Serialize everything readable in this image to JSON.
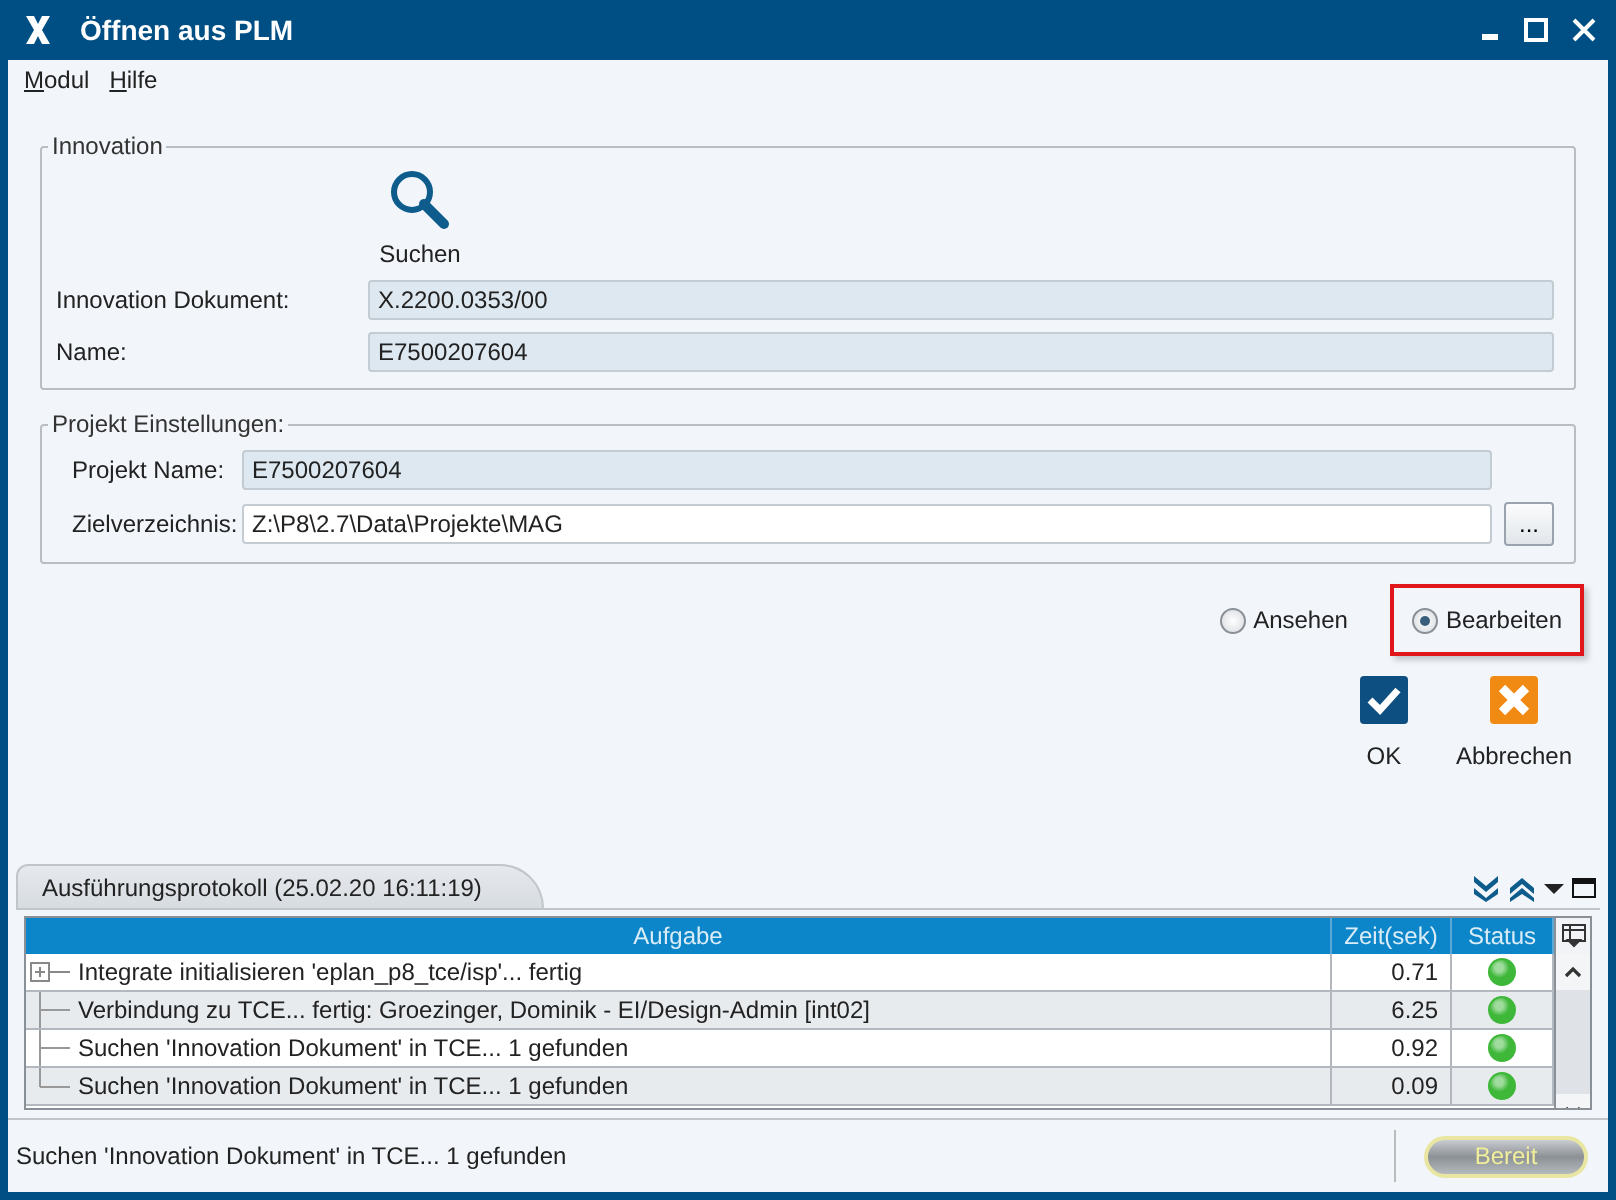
{
  "window": {
    "title": "Öffnen aus PLM"
  },
  "menu": [
    {
      "label": "Modul"
    },
    {
      "label": "Hilfe"
    }
  ],
  "innovation": {
    "legend": "Innovation",
    "search_label": "Suchen",
    "fields": [
      {
        "label": "Innovation Dokument:",
        "value": "X.2200.0353/00",
        "readonly": true
      },
      {
        "label": "Name:",
        "value": "E7500207604",
        "readonly": true
      }
    ]
  },
  "projekt": {
    "legend": "Projekt Einstellungen:",
    "fields": [
      {
        "label": "Projekt Name:",
        "value": "E7500207604",
        "readonly": true
      },
      {
        "label": "Zielverzeichnis:",
        "value": "Z:\\P8\\2.7\\Data\\Projekte\\MAG",
        "readonly": false,
        "browse": "..."
      }
    ]
  },
  "mode": [
    {
      "label": "Ansehen",
      "selected": false,
      "highlighted": false
    },
    {
      "label": "Bearbeiten",
      "selected": true,
      "highlighted": true
    }
  ],
  "actions": [
    {
      "kind": "ok",
      "label": "OK"
    },
    {
      "kind": "cancel",
      "label": "Abbrechen"
    }
  ],
  "log": {
    "tab": "Ausführungsprotokoll (25.02.20 16:11:19)",
    "columns": [
      "Aufgabe",
      "Zeit(sek)",
      "Status"
    ],
    "rows": [
      {
        "kind": "collapsed",
        "task": "Integrate initialisieren 'eplan_p8_tce/isp'... fertig",
        "time": "0.71",
        "color": "#3fb83a"
      },
      {
        "kind": "leaf",
        "task": "Verbindung zu TCE... fertig: Groezinger, Dominik - EI/Design-Admin [int02]",
        "time": "6.25",
        "color": "#3fb83a"
      },
      {
        "kind": "leaf",
        "task": "Suchen 'Innovation Dokument' in TCE... 1 gefunden",
        "time": "0.92",
        "color": "#3fb83a"
      },
      {
        "kind": "leaf",
        "task": "Suchen 'Innovation Dokument' in TCE... 1 gefunden",
        "time": "0.09",
        "color": "#3fb83a"
      }
    ]
  },
  "status_bar": {
    "message": "Suchen 'Innovation Dokument' in TCE... 1 gefunden",
    "state": "Bereit"
  }
}
